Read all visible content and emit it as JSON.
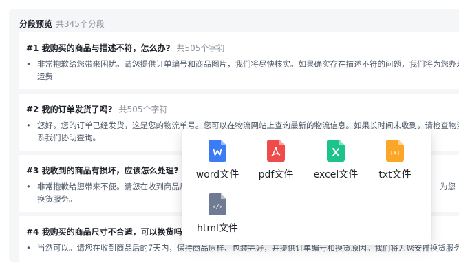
{
  "header": {
    "title": "分段预览",
    "count": "共345个分段"
  },
  "segments": [
    {
      "question": "#1 我购买的商品与描述不符，怎么办?",
      "chars": "共505个字符",
      "lines": [
        "非常抱歉给您带来困扰。请您提供订单编号和商品图片，我们将尽快核实。如果确实存在描述不符的问题，我们将为您办理退",
        "运费"
      ]
    },
    {
      "question": "#2 我的订单发货了吗?",
      "chars": "共505个字符",
      "lines": [
        "您好，您的订单已经发货，这是您的物流单号。您可以在物流网站上查询最新的物流信息。如果长时间未收到，请检查物流信",
        "系我们协助查询。"
      ]
    },
    {
      "question": "#3 我收到的商品有损坏，应该怎么处理?",
      "chars": "共5",
      "lines": [
        "非常抱歉给您带来不便。请您在收到商品后",
        "换货服务。"
      ],
      "tail": "为您"
    },
    {
      "question": "#4 我购买的商品尺寸不合适，可以换货吗?",
      "chars": "共",
      "lines": [
        "当然可以。请您在收到商品后的7天内，保持商品原样、包装完好，并提供订单编号和换货原因。我们将为您安排换货服务。"
      ]
    }
  ],
  "export_menu": {
    "options": [
      {
        "label": "word文件",
        "icon": "word-file-icon",
        "color": "#3b7cf6",
        "glyph": "W"
      },
      {
        "label": "pdf文件",
        "icon": "pdf-file-icon",
        "color": "#ef4b4b",
        "glyph": "PDF"
      },
      {
        "label": "excel文件",
        "icon": "excel-file-icon",
        "color": "#1ec28b",
        "glyph": "X"
      },
      {
        "label": "txt文件",
        "icon": "txt-file-icon",
        "color": "#fba626",
        "glyph": "TXT"
      },
      {
        "label": "html文件",
        "icon": "html-file-icon",
        "color": "#6e7b92",
        "glyph": "</>"
      }
    ]
  }
}
